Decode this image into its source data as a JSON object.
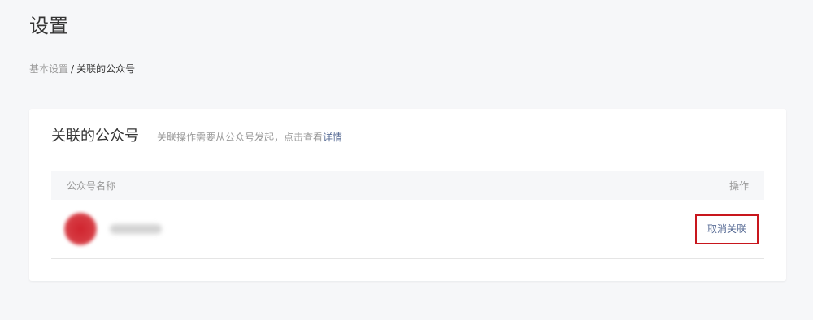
{
  "page": {
    "title": "设置"
  },
  "breadcrumb": {
    "parent": "基本设置",
    "separator": "/",
    "current": "关联的公众号"
  },
  "card": {
    "title": "关联的公众号",
    "hint_prefix": "关联操作需要从公众号发起，点击查看",
    "hint_link": "详情"
  },
  "table": {
    "columns": {
      "name": "公众号名称",
      "action": "操作"
    },
    "rows": [
      {
        "avatar_color": "#d0242e",
        "name_blurred": true,
        "action_label": "取消关联"
      }
    ]
  },
  "colors": {
    "background": "#f6f7f9",
    "link": "#576b95",
    "highlight_border": "#c8161d"
  }
}
